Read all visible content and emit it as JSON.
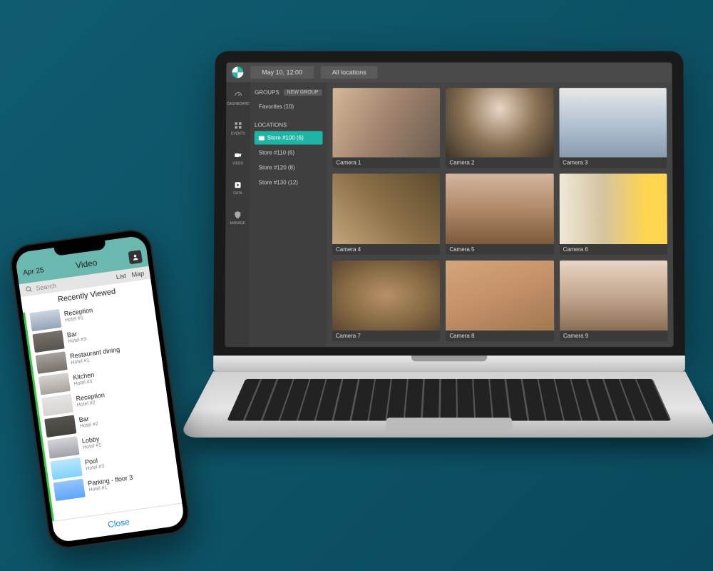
{
  "laptop": {
    "topbar": {
      "datetime": "May 10, 12:00",
      "location": "All locations"
    },
    "rail": [
      {
        "name": "dashboard",
        "label": "DASHBOARD"
      },
      {
        "name": "events",
        "label": "EVENTS"
      },
      {
        "name": "video",
        "label": "VIDEO"
      },
      {
        "name": "data",
        "label": "DATA"
      },
      {
        "name": "manage",
        "label": "MANAGE"
      }
    ],
    "sidebar": {
      "groups_label": "GROUPS",
      "new_group_label": "NEW GROUP",
      "favorites_label": "Favorites (10)",
      "locations_label": "LOCATIONS",
      "locations": [
        {
          "label": "Store #100 (6)",
          "active": true
        },
        {
          "label": "Store #110 (6)",
          "active": false
        },
        {
          "label": "Store #120 (8)",
          "active": false
        },
        {
          "label": "Store #130 (12)",
          "active": false
        }
      ]
    },
    "cameras": [
      {
        "label": "Camera 1"
      },
      {
        "label": "Camera 2"
      },
      {
        "label": "Camera 3"
      },
      {
        "label": "Camera 4"
      },
      {
        "label": "Camera 5"
      },
      {
        "label": "Camera 6"
      },
      {
        "label": "Camera 7"
      },
      {
        "label": "Camera 8"
      },
      {
        "label": "Camera 9"
      }
    ]
  },
  "phone": {
    "header": {
      "date": "Apr 25",
      "title": "Video"
    },
    "search": {
      "placeholder": "Search",
      "tab_list": "List",
      "tab_map": "Map"
    },
    "section_title": "Recently Viewed",
    "items": [
      {
        "name": "Reception",
        "sub": "Hotel #1"
      },
      {
        "name": "Bar",
        "sub": "Hotel #3"
      },
      {
        "name": "Restaurant dining",
        "sub": "Hotel #1"
      },
      {
        "name": "Kitchen",
        "sub": "Hotel #4"
      },
      {
        "name": "Reception",
        "sub": "Hotel #2"
      },
      {
        "name": "Bar",
        "sub": "Hotel #2"
      },
      {
        "name": "Lobby",
        "sub": "Hotel #1"
      },
      {
        "name": "Pool",
        "sub": "Hotel #3"
      },
      {
        "name": "Parking - floor 3",
        "sub": "Hotel #1"
      }
    ],
    "footer_close": "Close"
  }
}
